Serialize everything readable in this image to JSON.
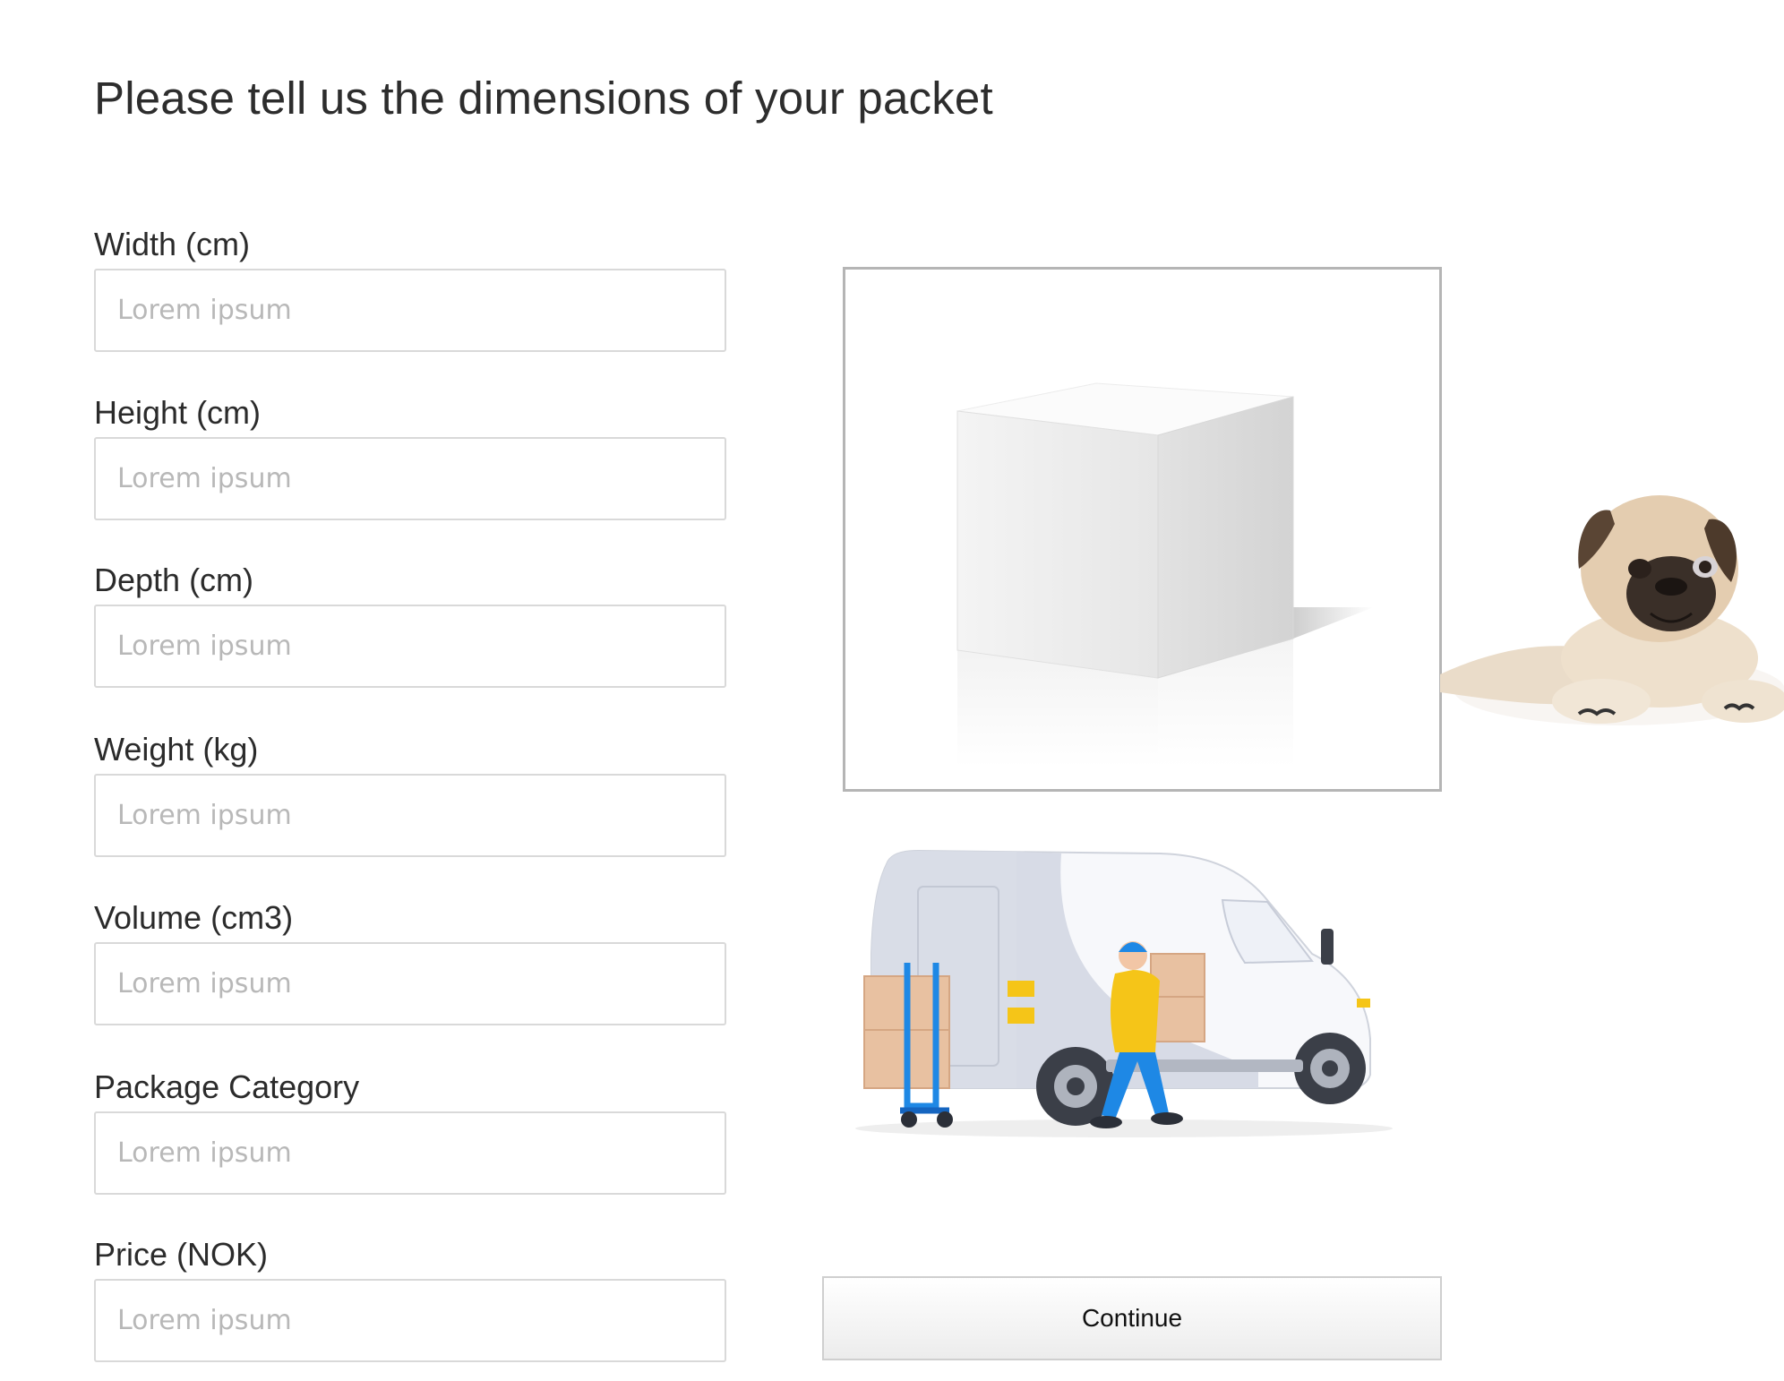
{
  "page": {
    "title": "Please tell us the dimensions of your packet"
  },
  "form": {
    "fields": [
      {
        "label": "Width (cm)",
        "placeholder": "Lorem ipsum",
        "value": ""
      },
      {
        "label": "Height (cm)",
        "placeholder": "Lorem ipsum",
        "value": ""
      },
      {
        "label": "Depth (cm)",
        "placeholder": "Lorem ipsum",
        "value": ""
      },
      {
        "label": "Weight (kg)",
        "placeholder": "Lorem ipsum",
        "value": ""
      },
      {
        "label": "Volume (cm3)",
        "placeholder": "Lorem ipsum",
        "value": ""
      },
      {
        "label": "Package Category",
        "placeholder": "Lorem ipsum",
        "value": ""
      },
      {
        "label": "Price (NOK)",
        "placeholder": "Lorem ipsum",
        "value": ""
      }
    ]
  },
  "images": {
    "box": "white-box-illustration",
    "dog": "pug-illustration",
    "van": "delivery-van-courier-illustration"
  },
  "actions": {
    "continue_label": "Continue"
  },
  "colors": {
    "input_border": "#d9d9d9",
    "placeholder": "#b8b8b8",
    "frame_border": "#b5b5b5",
    "courier_accent": "#f5c518",
    "courier_blue": "#1e88e5"
  }
}
